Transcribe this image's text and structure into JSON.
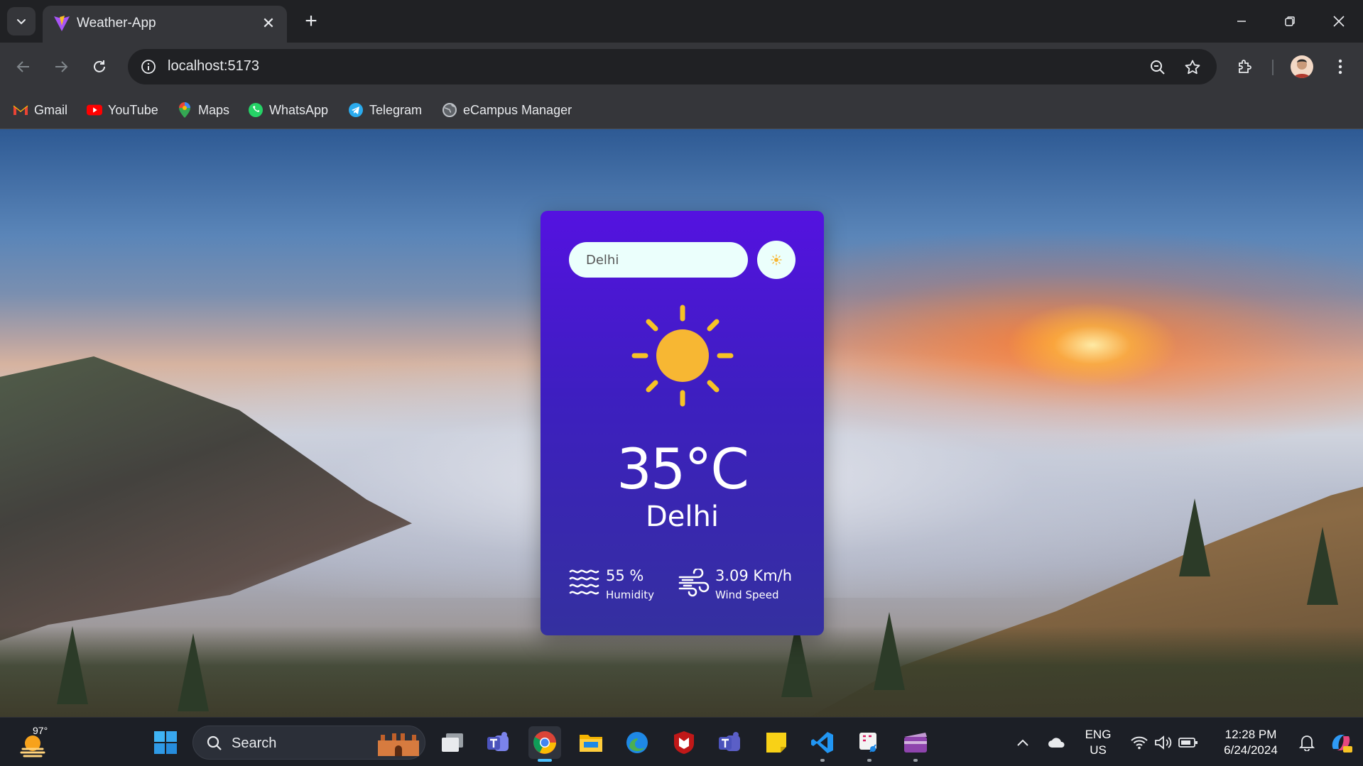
{
  "browser": {
    "tab_title": "Weather-App",
    "tab_close": "✕",
    "new_tab": "+",
    "url": "localhost:5173",
    "bookmarks": [
      "Gmail",
      "YouTube",
      "Maps",
      "WhatsApp",
      "Telegram",
      "eCampus Manager"
    ]
  },
  "app": {
    "search_value": "Delhi",
    "temperature": "35°C",
    "city": "Delhi",
    "humidity_value": "55 %",
    "humidity_label": "Humidity",
    "wind_value": "3.09 Km/h",
    "wind_label": "Wind Speed",
    "weather_icon": "sun-icon"
  },
  "taskbar": {
    "weather_temp": "97°",
    "search_label": "Search",
    "lang_line1": "ENG",
    "lang_line2": "US",
    "time": "12:28 PM",
    "date": "6/24/2024"
  },
  "colors": {
    "card_top": "#5412e0",
    "card_bottom": "#34309f",
    "input_bg": "#ebfffc",
    "sun": "#f7b733",
    "chrome_dark": "#202124",
    "chrome_toolbar": "#35363a"
  }
}
